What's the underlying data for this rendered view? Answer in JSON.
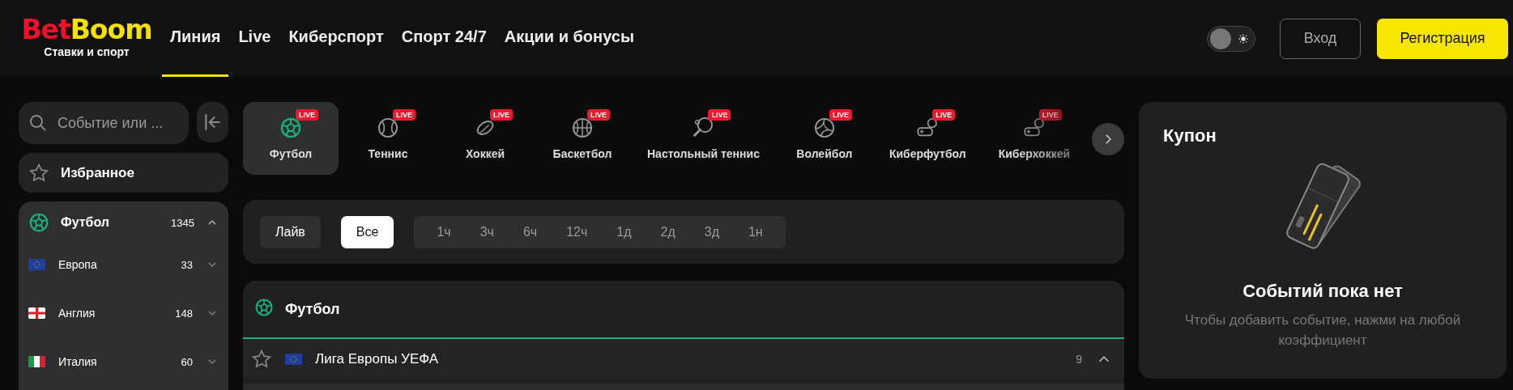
{
  "logo": {
    "part1": "Bet",
    "part2": "Boom",
    "tagline": "Ставки и спорт"
  },
  "nav": [
    {
      "label": "Линия",
      "selected": true
    },
    {
      "label": "Live",
      "selected": false
    },
    {
      "label": "Киберспорт",
      "selected": false
    },
    {
      "label": "Спорт 24/7",
      "selected": false
    },
    {
      "label": "Акции и бонусы",
      "selected": false
    }
  ],
  "theme_toggle": {
    "on": false
  },
  "header_buttons": [
    {
      "label": "Вход",
      "kind": "outline"
    },
    {
      "label": "Регистрация",
      "kind": "primary"
    }
  ],
  "sidebar": {
    "search": {
      "placeholder": "Событие или ..."
    },
    "favorites": {
      "label": "Избранное"
    },
    "sports": [
      {
        "label": "Футбол",
        "count": "1345",
        "expanded": true,
        "children": [
          {
            "label": "Европа",
            "count": "33",
            "kind": "eu",
            "expanded": false
          },
          {
            "label": "Англия",
            "count": "148",
            "kind": "england",
            "expanded": false
          },
          {
            "label": "Италия",
            "count": "60",
            "kind": "italy",
            "expanded": false
          }
        ]
      }
    ]
  },
  "sport_tabs": [
    {
      "label": "Футбол",
      "kind": "football",
      "badge": "LIVE",
      "selected": true
    },
    {
      "label": "Теннис",
      "kind": "tennis",
      "badge": "LIVE",
      "selected": false
    },
    {
      "label": "Хоккей",
      "kind": "hockey",
      "badge": "LIVE",
      "selected": false
    },
    {
      "label": "Баскетбол",
      "kind": "basketball",
      "badge": "LIVE",
      "selected": false
    },
    {
      "label": "Настольный теннис",
      "kind": "tabletennis",
      "badge": "LIVE",
      "selected": false
    },
    {
      "label": "Волейбол",
      "kind": "volleyball",
      "badge": "LIVE",
      "selected": false
    },
    {
      "label": "Киберфутбол",
      "kind": "gamepad",
      "badge": "LIVE",
      "selected": false
    },
    {
      "label": "Киберхоккей",
      "kind": "gamepad",
      "badge": "LIVE",
      "selected": false
    }
  ],
  "filters": {
    "modes": [
      {
        "label": "Лайв",
        "selected": false
      },
      {
        "label": "Все",
        "selected": true
      }
    ],
    "periods": [
      {
        "label": "1ч",
        "selected": false
      },
      {
        "label": "3ч",
        "selected": false
      },
      {
        "label": "6ч",
        "selected": false
      },
      {
        "label": "12ч",
        "selected": false
      },
      {
        "label": "1д",
        "selected": false
      },
      {
        "label": "2д",
        "selected": false
      },
      {
        "label": "3д",
        "selected": false
      },
      {
        "label": "1н",
        "selected": false
      }
    ]
  },
  "events": {
    "title": "Футбол",
    "leagues": [
      {
        "name": "Лига Европы УЕФА",
        "kind": "eu",
        "count": "9",
        "expanded": true
      }
    ]
  },
  "coupon": {
    "title": "Купон",
    "empty_title": "Событий пока нет",
    "empty_hint": "Чтобы добавить событие, нажми на любой коэффициент"
  }
}
